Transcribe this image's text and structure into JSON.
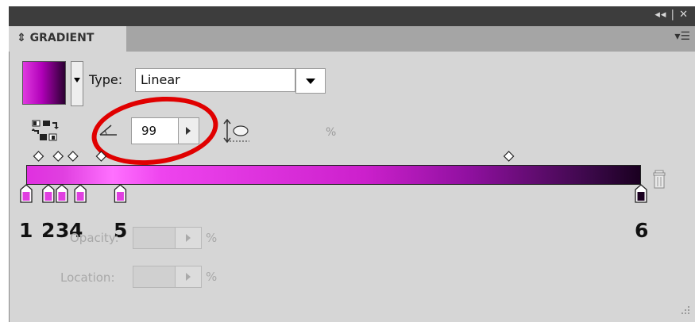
{
  "panel": {
    "title": "GRADIENT",
    "collapse_icon": "double-chevron-left-icon",
    "close_icon": "close-icon",
    "collapse_text": "◂◂ | ✕",
    "menu_icon": "panel-menu-icon"
  },
  "swatch": {
    "colors": [
      "#e03ae0",
      "#b000b8",
      "#2a0030"
    ]
  },
  "type": {
    "label": "Type:",
    "value": "Linear"
  },
  "angle": {
    "value": "99"
  },
  "aspect": {
    "unit": "%"
  },
  "gradient": {
    "stop_labels": [
      "1",
      "2",
      "3",
      "4",
      "5",
      "6"
    ],
    "stop_positions_pct": [
      0,
      3.6,
      5.8,
      8.8,
      15.3,
      100
    ],
    "midpoint_positions_pct": [
      2,
      5.2,
      7.6,
      12.2,
      78.5
    ],
    "colors": {
      "stop_fill": "#e040e0",
      "last_stop_fill": "#1a0020",
      "highlight": "#e00000"
    }
  },
  "opacity": {
    "label": "Opacity:",
    "value": "",
    "unit": "%"
  },
  "location": {
    "label": "Location:",
    "value": "",
    "unit": "%"
  }
}
